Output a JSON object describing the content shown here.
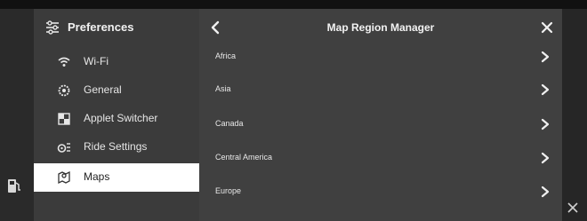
{
  "sidebar": {
    "title": "Preferences",
    "items": [
      {
        "label": "Wi-Fi",
        "icon": "wifi-icon"
      },
      {
        "label": "General",
        "icon": "gear-icon"
      },
      {
        "label": "Applet Switcher",
        "icon": "applet-switcher-icon"
      },
      {
        "label": "Ride Settings",
        "icon": "ride-settings-icon"
      },
      {
        "label": "Maps",
        "icon": "map-icon",
        "active": true
      }
    ]
  },
  "content": {
    "title": "Map Region Manager",
    "regions": [
      "Africa",
      "Asia",
      "Canada",
      "Central America",
      "Europe"
    ]
  },
  "colors": {
    "active_item_bg": "#ffffff",
    "panel_bg": "#404040",
    "sidebar_bg": "#3b3b3b"
  }
}
